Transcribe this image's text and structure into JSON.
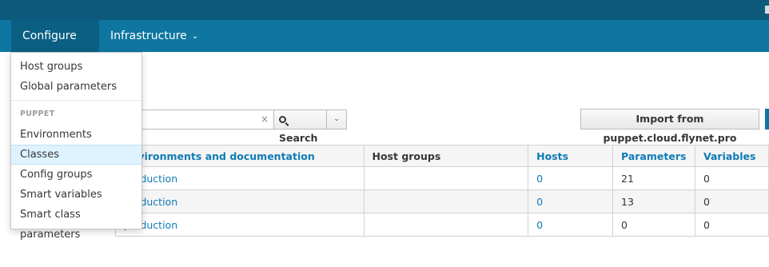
{
  "topnav": {
    "configure_label": "Configure",
    "infrastructure_label": "Infrastructure"
  },
  "configure_menu": {
    "items_top": [
      "Host groups",
      "Global parameters"
    ],
    "section_header": "PUPPET",
    "items_puppet": [
      "Environments",
      "Classes",
      "Config groups",
      "Smart variables",
      "Smart class parameters"
    ],
    "highlighted": "Classes"
  },
  "search": {
    "value": "",
    "clear_glyph": "×",
    "button_label": "Search"
  },
  "toolbar": {
    "import_label": "Import from puppet.cloud.flynet.pro"
  },
  "table": {
    "headers": {
      "environments": "Environments and documentation",
      "host_groups": "Host groups",
      "hosts": "Hosts",
      "parameters": "Parameters",
      "variables": "Variables"
    },
    "rows": [
      {
        "environment": "production",
        "host_groups": "",
        "hosts": "0",
        "parameters": "21",
        "variables": "0"
      },
      {
        "environment": "production",
        "host_groups": "",
        "hosts": "0",
        "parameters": "13",
        "variables": "0"
      },
      {
        "environment": "production",
        "host_groups": "",
        "hosts": "0",
        "parameters": "0",
        "variables": "0"
      }
    ]
  },
  "colors": {
    "topbar": "#0d5a7c",
    "navbar": "#0e76a1",
    "link": "#0f7bb5",
    "menu_highlight": "#def3ff"
  }
}
